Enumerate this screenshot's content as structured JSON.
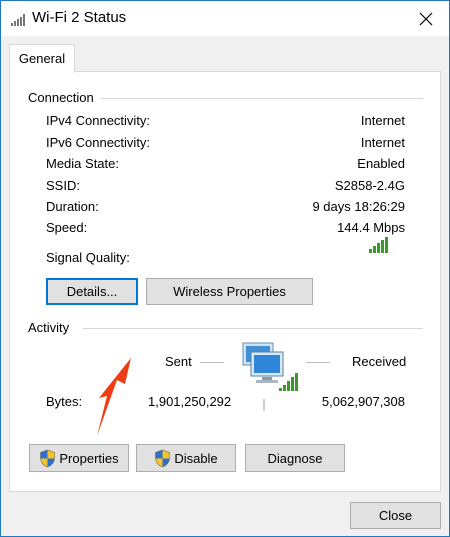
{
  "window": {
    "title": "Wi-Fi 2 Status",
    "tab_general": "General"
  },
  "connection": {
    "section_label": "Connection",
    "rows": [
      {
        "label": "IPv4 Connectivity:",
        "value": "Internet"
      },
      {
        "label": "IPv6 Connectivity:",
        "value": "Internet"
      },
      {
        "label": "Media State:",
        "value": "Enabled"
      },
      {
        "label": "SSID:",
        "value": "S2858-2.4G"
      },
      {
        "label": "Duration:",
        "value": "9 days 18:26:29"
      },
      {
        "label": "Speed:",
        "value": "144.4 Mbps"
      }
    ],
    "signal_label": "Signal Quality:",
    "signal_bars_filled": 5,
    "signal_bars_total": 5,
    "details_button": "Details...",
    "wireless_properties_button": "Wireless Properties"
  },
  "activity": {
    "section_label": "Activity",
    "sent_label": "Sent",
    "received_label": "Received",
    "bytes_label": "Bytes:",
    "bytes_sent": "1,901,250,292",
    "bytes_received": "5,062,907,308"
  },
  "buttons": {
    "properties": "Properties",
    "disable": "Disable",
    "diagnose": "Diagnose",
    "close": "Close"
  },
  "colors": {
    "signal_green": "#3a9a2a",
    "accent_blue": "#0078d7",
    "annotation_arrow": "#f03c14"
  },
  "icons": {
    "title": "wifi-signal-icon",
    "close": "close-icon",
    "shield": "uac-shield-icon",
    "network": "network-computers-icon",
    "annotation": "red-arrow-annotation"
  }
}
